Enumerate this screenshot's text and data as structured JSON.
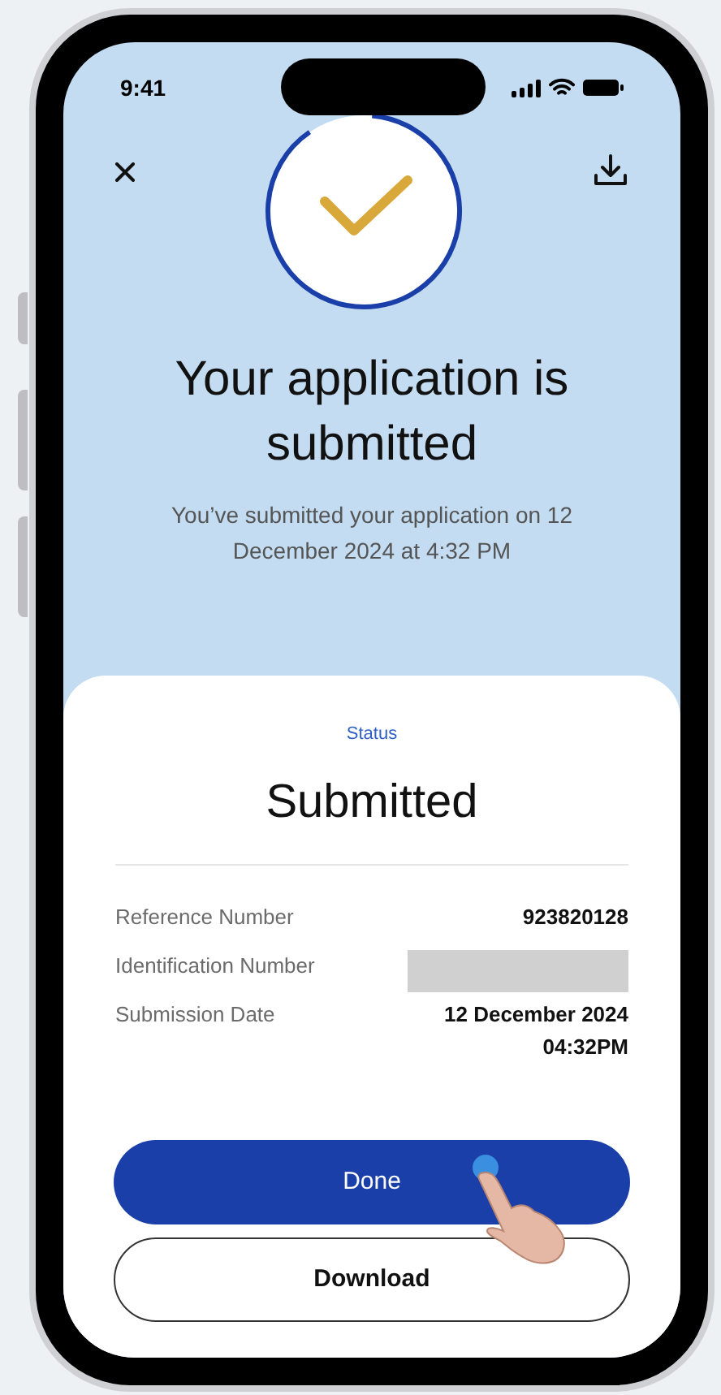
{
  "status_bar": {
    "time": "9:41"
  },
  "header": {
    "title": "Your application is submitted",
    "subtitle": "You’ve submitted your application on 12 December 2024 at 4:32 PM"
  },
  "status": {
    "label": "Status",
    "value": "Submitted"
  },
  "details": [
    {
      "label": "Reference Number",
      "value": "923820128",
      "redacted": false
    },
    {
      "label": "Identification Number",
      "redacted": true
    },
    {
      "label": "Submission Date",
      "value": "12 December 2024\n04:32PM",
      "redacted": false
    }
  ],
  "buttons": [
    {
      "label": "Done",
      "kind": "primary"
    },
    {
      "label": "Download",
      "kind": "outline"
    }
  ]
}
